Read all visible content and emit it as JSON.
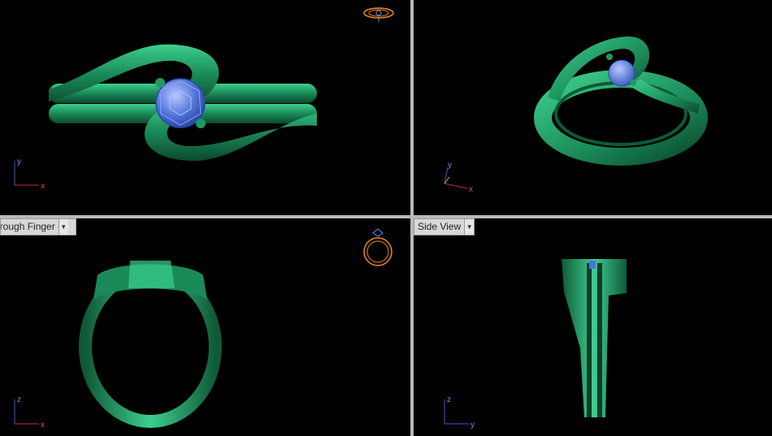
{
  "app": {
    "colors": {
      "background": "#000000",
      "ring_metal": "#1a8a58",
      "gem": "#5a7fe0",
      "divider": "#b9b9b9"
    }
  },
  "viewports": {
    "top_left": {
      "label": "",
      "axes": {
        "h": "x",
        "v": "y"
      },
      "nav_icon": "ring-top-nav-icon"
    },
    "top_right": {
      "label": "",
      "axes": {
        "h": "x",
        "v": "y"
      }
    },
    "bottom_left": {
      "label": "Through Finger",
      "label_visible": "hrough Finger",
      "axes": {
        "h": "x",
        "v": "z"
      },
      "nav_icon": "ring-front-nav-icon"
    },
    "bottom_right": {
      "label": "Side View",
      "axes": {
        "h": "y",
        "v": "z"
      }
    }
  },
  "icons": {
    "dropdown": "chevron-down-icon"
  }
}
